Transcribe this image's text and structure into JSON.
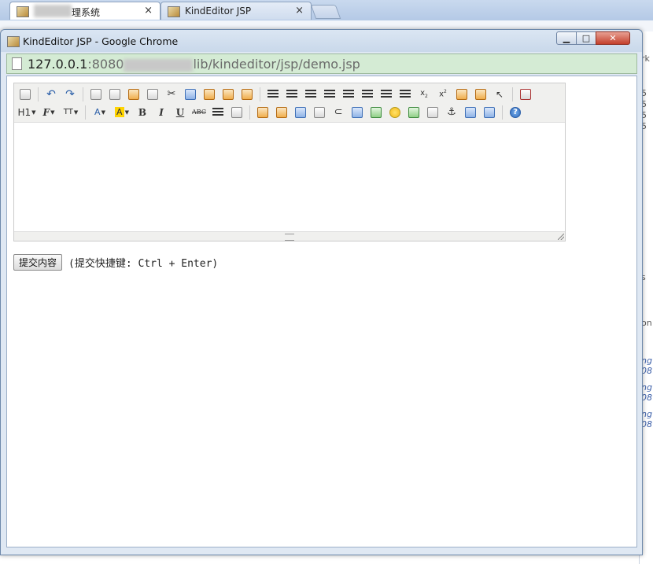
{
  "background_browser": {
    "tabs": [
      {
        "label": "理系统",
        "active": true,
        "close": "×"
      },
      {
        "label": "KindEditor JSP",
        "active": false,
        "close": "×"
      }
    ],
    "right_edge_fragments": [
      "rk",
      "5",
      "5",
      "5",
      "5",
      "s",
      "on",
      "ng",
      "08",
      "ng",
      "08",
      "ng",
      "08"
    ]
  },
  "window": {
    "title": "KindEditor JSP - Google Chrome",
    "controls": {
      "minimize": "▁",
      "maximize": "□",
      "close": "✕"
    },
    "address": {
      "host": "127.0.0.1",
      "port": ":8080",
      "path": "lib/kindeditor/jsp/demo.jsp"
    }
  },
  "editor": {
    "toolbar_row1": [
      "source-icon",
      "sep",
      "undo-icon",
      "redo-icon",
      "sep",
      "preview-icon",
      "print-icon",
      "template-icon",
      "code-icon",
      "cut-icon",
      "copy-icon",
      "paste-icon",
      "plainpaste-icon",
      "wordpaste-icon",
      "sep",
      "justifyleft-icon",
      "justifycenter-icon",
      "justifyright-icon",
      "justifyfull-icon",
      "insertorderedlist-icon",
      "insertunorderedlist-icon",
      "indent-icon",
      "outdent-icon",
      "subscript-icon",
      "superscript-icon",
      "clearhtml-icon",
      "quickformat-icon",
      "selectall-icon",
      "sep",
      "fullscreen-icon"
    ],
    "toolbar_row2": {
      "formatblock": "H1",
      "fontname": "F",
      "fontsize": "TT",
      "forecolor": "A",
      "hilitecolor": "A",
      "bold": "B",
      "italic": "I",
      "underline": "U",
      "strikethrough": "ABC"
    },
    "content": ""
  },
  "submit": {
    "button_label": "提交内容",
    "hint": "(提交快捷键: Ctrl + Enter)"
  }
}
